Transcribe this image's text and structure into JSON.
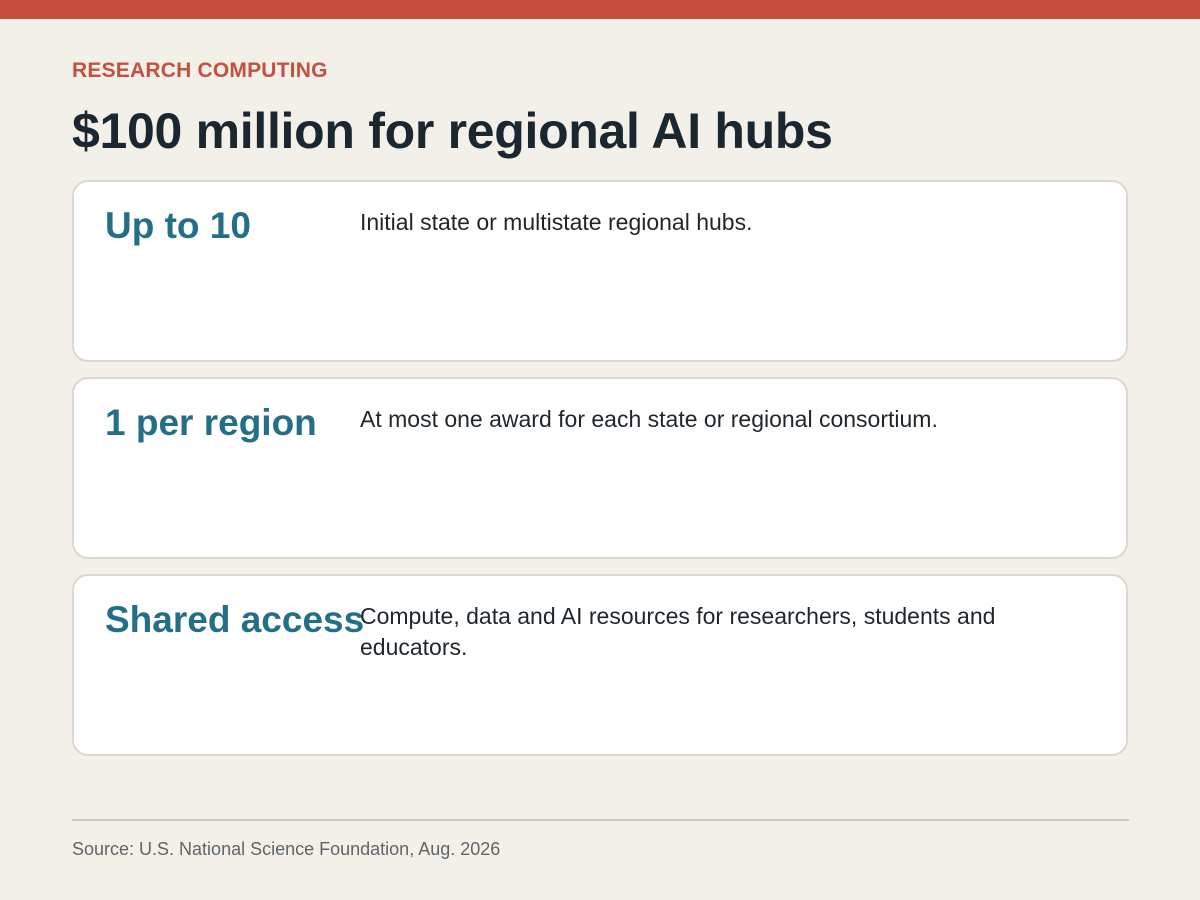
{
  "header": {
    "kicker": "RESEARCH COMPUTING",
    "title": "$100 million for regional AI hubs"
  },
  "cards": [
    {
      "stat": "Up to 10",
      "description": "Initial state or multistate regional hubs."
    },
    {
      "stat": "1 per region",
      "description": "At most one award for each state or regional consortium."
    },
    {
      "stat": "Shared access",
      "description": "Compute, data and AI resources for researchers, students and educators."
    }
  ],
  "footer": {
    "source": "Source: U.S. National Science Foundation, Aug. 2026"
  },
  "colors": {
    "accent": "#c84f3e",
    "stat": "#236f87",
    "background": "#f3f0e9"
  }
}
